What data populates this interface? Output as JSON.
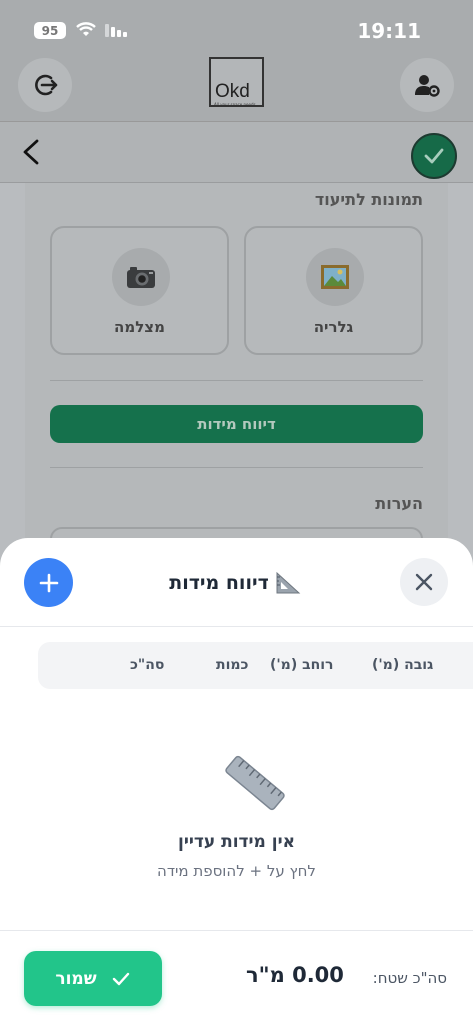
{
  "status_bar": {
    "battery": "95",
    "time": "19:11"
  },
  "header": {
    "logo_text": "Okd",
    "logo_tagline": "All your space needs"
  },
  "background_page": {
    "photos_section_title": "תמונות לתיעוד",
    "gallery_label": "גלריה",
    "camera_label": "מצלמה",
    "measurement_report_button": "דיווח מידות",
    "notes_section_title": "הערות"
  },
  "sheet": {
    "title": "דיווח מידות",
    "columns": [
      "גובה (מ')",
      "רוחב (מ')",
      "כמות",
      "סה\"כ"
    ],
    "empty_title": "אין מידות עדיין",
    "empty_subtitle": "לחץ על + להוספת מידה",
    "total_label": "סה\"כ שטח:",
    "total_value": "0.00 מ\"ר",
    "save_label": "שמור"
  },
  "colors": {
    "primary_blue": "#3b82f6",
    "save_green": "#22c58a",
    "header_green": "#15714c"
  }
}
